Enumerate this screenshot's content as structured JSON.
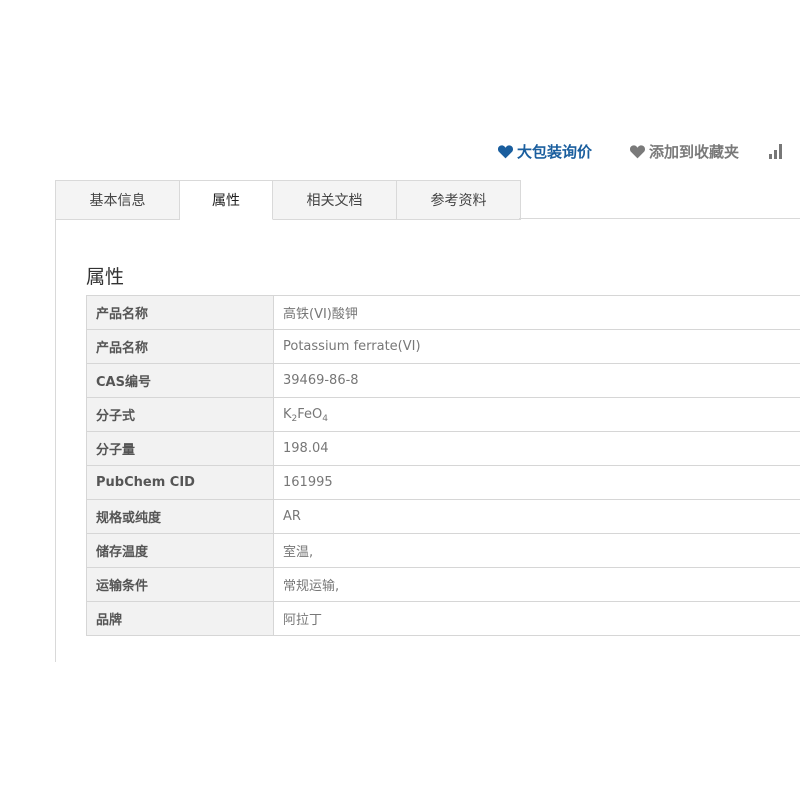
{
  "actions": {
    "bulk_inquiry": {
      "label": "大包装询价",
      "icon": "heart-icon",
      "color": "#1a5e9e"
    },
    "add_favorite": {
      "label": "添加到收藏夹",
      "icon": "heart-icon",
      "color": "#7a7a7a"
    },
    "compare": {
      "icon": "bar-chart-icon"
    }
  },
  "tabs": [
    {
      "label": "基本信息",
      "active": false
    },
    {
      "label": "属性",
      "active": true
    },
    {
      "label": "相关文档",
      "active": false
    },
    {
      "label": "参考资料",
      "active": false
    }
  ],
  "section": {
    "title": "属性"
  },
  "properties": [
    {
      "label": "产品名称",
      "value": "高铁(VI)酸钾"
    },
    {
      "label": "产品名称",
      "value": "Potassium ferrate(VI)"
    },
    {
      "label": "CAS编号",
      "value": "39469-86-8"
    },
    {
      "label": "分子式",
      "value": "K2FeO4",
      "parts": [
        "K",
        "2",
        "FeO",
        "4"
      ]
    },
    {
      "label": "分子量",
      "value": "198.04"
    },
    {
      "label": "PubChem CID",
      "value": "161995"
    },
    {
      "label": "规格或纯度",
      "value": "AR"
    },
    {
      "label": "储存温度",
      "value": "室温,"
    },
    {
      "label": "运输条件",
      "value": "常规运输,"
    },
    {
      "label": "品牌",
      "value": "阿拉丁"
    }
  ]
}
